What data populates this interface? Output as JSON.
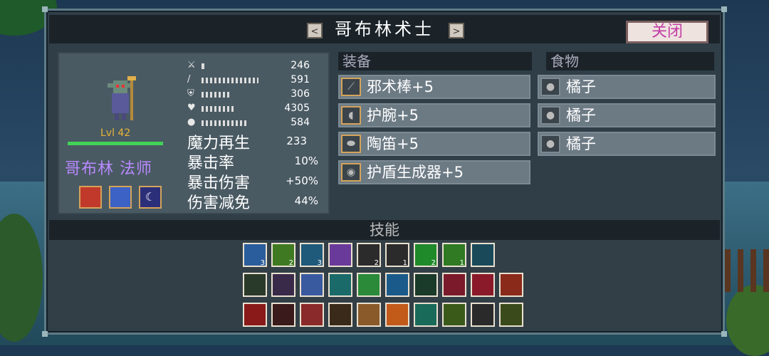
{
  "window": {
    "title": "哥布林术士",
    "prev_label": "<",
    "next_label": ">",
    "close_label": "关闭"
  },
  "character": {
    "level": "Lvl 42",
    "name": "哥布林 法师",
    "hp_fraction": 1.0,
    "buffs": [
      {
        "icon": "red-arrow-up-icon",
        "color": "#c0392b"
      },
      {
        "icon": "blue-staff-shield-icon",
        "color": "#3b62c4"
      },
      {
        "icon": "crescent-moon-icon",
        "color": "#2b2f7a"
      }
    ],
    "stats": [
      {
        "icon": "sword-icon",
        "glyph": "⚔",
        "value": "246"
      },
      {
        "icon": "wand-icon",
        "glyph": "/",
        "value": "591"
      },
      {
        "icon": "shield-icon",
        "glyph": "⛨",
        "value": "306"
      },
      {
        "icon": "heart-icon",
        "glyph": "♥",
        "value": "4305"
      },
      {
        "icon": "boot-icon",
        "glyph": "●",
        "value": "584"
      }
    ],
    "attributes": [
      {
        "label": "魔力再生",
        "value": "233"
      },
      {
        "label": "暴击率",
        "value": "10%"
      },
      {
        "label": "暴击伤害",
        "value": "+50%"
      },
      {
        "label": "伤害减免",
        "value": "44%"
      }
    ]
  },
  "equipment": {
    "header": "装备",
    "items": [
      {
        "icon": "staff-icon",
        "glyph": "⟋",
        "name": "邪术棒+5"
      },
      {
        "icon": "bracer-icon",
        "glyph": "◖",
        "name": "护腕+5"
      },
      {
        "icon": "ocarina-icon",
        "glyph": "⬬",
        "name": "陶笛+5"
      },
      {
        "icon": "shield-generator-icon",
        "glyph": "◉",
        "name": "护盾生成器+5"
      }
    ]
  },
  "food": {
    "header": "食物",
    "items": [
      {
        "icon": "orange-icon",
        "glyph": "●",
        "name": "橘子"
      },
      {
        "icon": "orange-icon",
        "glyph": "●",
        "name": "橘子"
      },
      {
        "icon": "orange-icon",
        "glyph": "●",
        "name": "橘子"
      }
    ]
  },
  "skills": {
    "header": "技能",
    "rows": [
      [
        {
          "icon": "shield-spell-icon",
          "bg": "#2a5d9c",
          "count": "3"
        },
        {
          "icon": "green-ring-icon",
          "bg": "#3f7a22",
          "count": "2"
        },
        {
          "icon": "wave-icon",
          "bg": "#1f5a7a",
          "count": "3"
        },
        {
          "icon": "purple-star-icon",
          "bg": "#6a3a9a",
          "count": ""
        },
        {
          "icon": "lightning-icon",
          "bg": "#2b2b2b",
          "count": "2"
        },
        {
          "icon": "chain-lightning-icon",
          "bg": "#2b2b2b",
          "count": "1"
        },
        {
          "icon": "green-burst-icon",
          "bg": "#1f8a2a",
          "count": "2"
        },
        {
          "icon": "green-cloud-icon",
          "bg": "#2f7a22",
          "count": "1"
        },
        {
          "icon": "cyan-cog-icon",
          "bg": "#1a4a5a",
          "count": ""
        }
      ],
      [
        {
          "icon": "green-flask-icon",
          "bg": "#2a3a2a",
          "count": ""
        },
        {
          "icon": "purple-arrow-icon",
          "bg": "#3a2a4a",
          "count": ""
        },
        {
          "icon": "crystal-icon",
          "bg": "#3a5aa0",
          "count": ""
        },
        {
          "icon": "teal-shield-icon",
          "bg": "#1a6a6a",
          "count": ""
        },
        {
          "icon": "green-box-icon",
          "bg": "#2a8a3a",
          "count": ""
        },
        {
          "icon": "target-icon",
          "bg": "#1a5a8a",
          "count": ""
        },
        {
          "icon": "green-orb-icon",
          "bg": "#1a3a2a",
          "count": ""
        },
        {
          "icon": "red-lightning-icon",
          "bg": "#7a1a2a",
          "count": ""
        },
        {
          "icon": "red-bolt-icon",
          "bg": "#8a1a2a",
          "count": ""
        },
        {
          "icon": "flame-icon",
          "bg": "#8a2a1a",
          "count": ""
        }
      ],
      [
        {
          "icon": "red-eye-icon",
          "bg": "#8a1a1a",
          "count": ""
        },
        {
          "icon": "dice-icon",
          "bg": "#3a1a1a",
          "count": ""
        },
        {
          "icon": "dots-icon",
          "bg": "#8a2a2a",
          "count": ""
        },
        {
          "icon": "fire-tower-icon",
          "bg": "#3a2a1a",
          "count": ""
        },
        {
          "icon": "hourglass-icon",
          "bg": "#8a5a2a",
          "count": ""
        },
        {
          "icon": "heart-orange-icon",
          "bg": "#c25a1a",
          "count": ""
        },
        {
          "icon": "spiral-icon",
          "bg": "#1a6a5a",
          "count": ""
        },
        {
          "icon": "demon-face-icon",
          "bg": "#3a5a1a",
          "count": ""
        },
        {
          "icon": "lightbulb-icon",
          "bg": "#2a2a2a",
          "count": ""
        },
        {
          "icon": "crown-ring-icon",
          "bg": "#3a4a1a",
          "count": ""
        }
      ]
    ]
  }
}
